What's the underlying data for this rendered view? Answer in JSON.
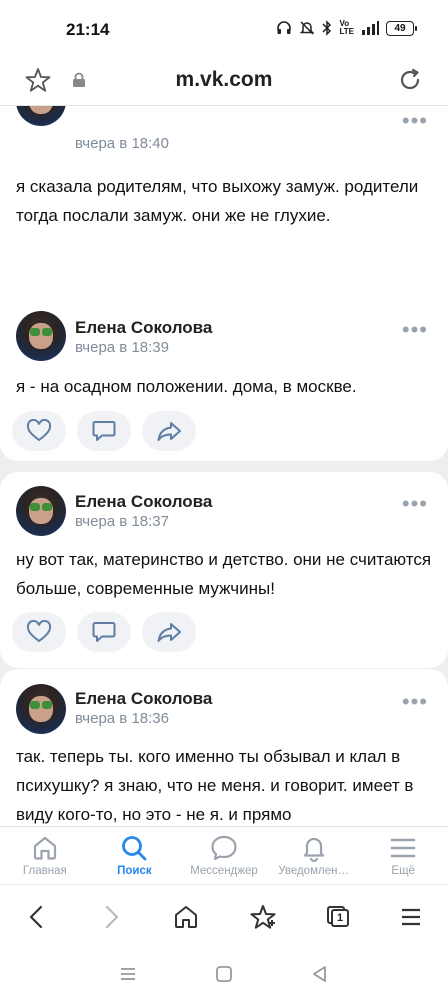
{
  "status_bar": {
    "time": "21:14",
    "battery": "49"
  },
  "url_bar": {
    "url": "m.vk.com"
  },
  "posts": [
    {
      "author": "",
      "time": "вчера в 18:40",
      "text": "я сказала родителям, что выхожу замуж. родители тогда послали замуж. они же не глухие."
    },
    {
      "author": "Елена Соколова",
      "time": "вчера в 18:39",
      "text": "я - на осадном положении. дома, в москве."
    },
    {
      "author": "Елена Соколова",
      "time": "вчера в 18:37",
      "text": "ну вот так, материнство и детство. они не считаются больше, современные мужчины!"
    },
    {
      "author": "Елена Соколова",
      "time": "вчера в 18:36",
      "text": "так. теперь ты. кого именно ты обзывал и клал в психушку? я знаю, что не меня. и говорит. имеет в виду кого-то, но это - не я. и прямо"
    }
  ],
  "bottom_nav": [
    {
      "label": "Главная",
      "icon": "home-icon",
      "active": false
    },
    {
      "label": "Поиск",
      "icon": "search-icon",
      "active": true
    },
    {
      "label": "Мессенджер",
      "icon": "messenger-icon",
      "active": false
    },
    {
      "label": "Уведомлен…",
      "icon": "bell-icon",
      "active": false
    },
    {
      "label": "Ещё",
      "icon": "menu-icon",
      "active": false
    }
  ],
  "browser_bar": {
    "tabs_count": "1"
  },
  "colors": {
    "accent": "#2688eb",
    "inactive": "#99a2ad",
    "background": "#edeef0"
  }
}
